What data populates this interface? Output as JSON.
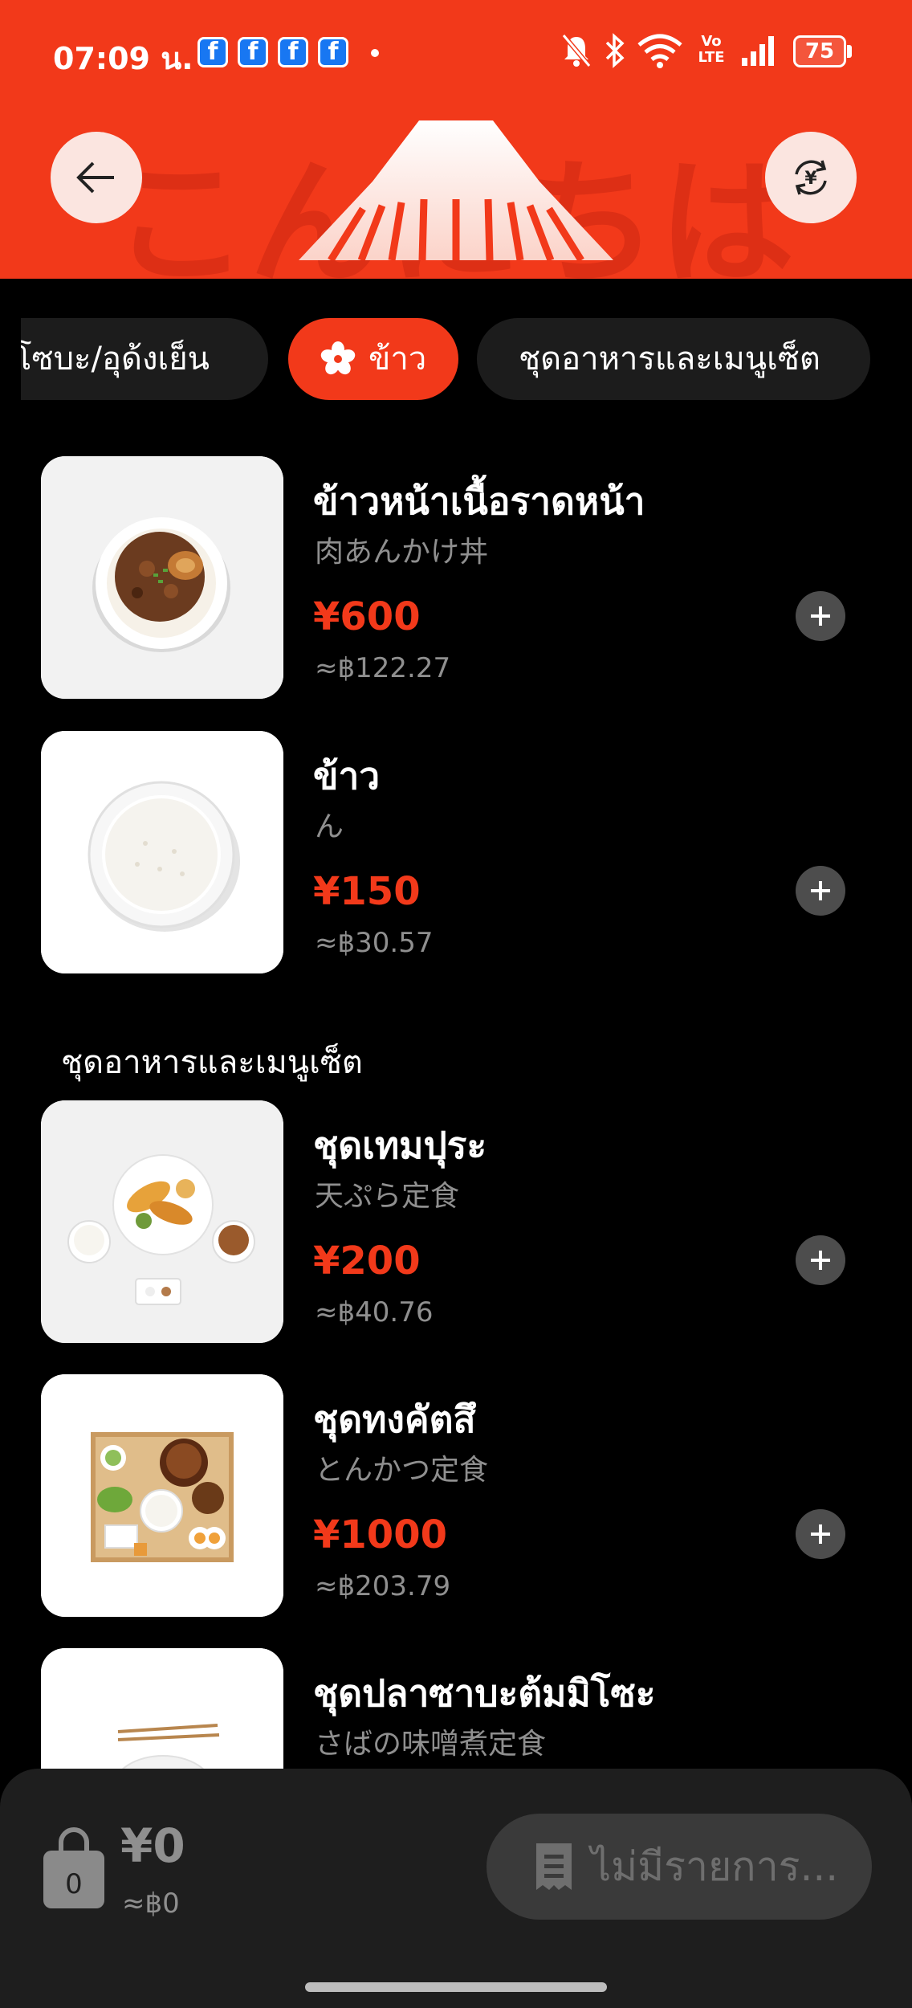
{
  "status_bar": {
    "time": "07:09 น.",
    "notification_icons": [
      "facebook-icon",
      "facebook-icon",
      "facebook-icon",
      "facebook-icon"
    ],
    "network_label": "Vo LTE",
    "battery": "75"
  },
  "header": {
    "background_text": "こんにちは",
    "back_icon": "arrow-left-icon",
    "currency_icon": "yen-exchange-icon",
    "logo_icon": "mount-fuji-icon",
    "color": "#f2391a"
  },
  "tabs": [
    {
      "label": "โซบะ/อุด้งเย็น",
      "active": false
    },
    {
      "label": "ข้าว",
      "active": true,
      "icon": "sakura-icon"
    },
    {
      "label": "ชุดอาหารและเมนูเซ็ต",
      "active": false
    }
  ],
  "rice_items": [
    {
      "name": "ข้าวหน้าเนื้อราดหน้า",
      "subtitle": "肉あんかけ丼",
      "price": "¥600",
      "thb": "≈฿122.27"
    },
    {
      "name": "ข้าว",
      "subtitle": "ん",
      "price": "¥150",
      "thb": "≈฿30.57"
    }
  ],
  "section_title": "ชุดอาหารและเมนูเซ็ต",
  "set_items": [
    {
      "name": "ชุดเทมปุระ",
      "subtitle": "天ぷら定食",
      "price": "¥200",
      "thb": "≈฿40.76"
    },
    {
      "name": "ชุดทงคัตสึ",
      "subtitle": "とんかつ定食",
      "price": "¥1000",
      "thb": "≈฿203.79"
    },
    {
      "name": "ชุดปลาซาบะต้มมิโซะ",
      "subtitle": "さばの味噌煮定食",
      "price": "",
      "thb": ""
    }
  ],
  "cart": {
    "count": "0",
    "total": "¥0",
    "total_thb": "≈฿0",
    "order_label": "ไม่มีรายการ...",
    "order_icon": "receipt-icon"
  }
}
